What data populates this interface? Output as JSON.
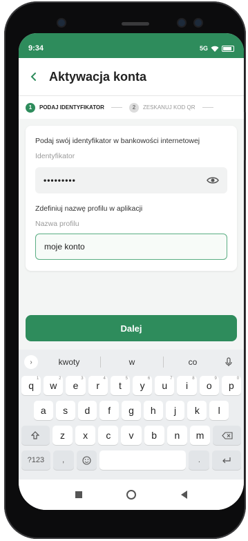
{
  "status_bar": {
    "time": "9:34",
    "signal": "5G"
  },
  "header": {
    "title": "Aktywacja konta"
  },
  "stepper": [
    {
      "number": "1",
      "label": "PODAJ IDENTYFIKATOR",
      "active": true
    },
    {
      "number": "2",
      "label": "ZESKANUJ KOD QR",
      "active": false
    }
  ],
  "form": {
    "intro": "Podaj swój identyfikator w bankowości internetowej",
    "identifier_label": "Identyfikator",
    "identifier_value": "•••••••••",
    "profile_intro": "Zdefiniuj nazwę profilu w aplikacji",
    "profile_label": "Nazwa profilu",
    "profile_value": "moje konto"
  },
  "button": {
    "label": "Dalej"
  },
  "keyboard": {
    "suggestions": [
      "kwoty",
      "w",
      "co"
    ],
    "row1": [
      [
        "q",
        "1"
      ],
      [
        "w",
        "2"
      ],
      [
        "e",
        "3"
      ],
      [
        "r",
        "4"
      ],
      [
        "t",
        "5"
      ],
      [
        "y",
        "6"
      ],
      [
        "u",
        "7"
      ],
      [
        "i",
        "8"
      ],
      [
        "o",
        "9"
      ],
      [
        "p",
        "0"
      ]
    ],
    "row2": [
      "a",
      "s",
      "d",
      "f",
      "g",
      "h",
      "j",
      "k",
      "l"
    ],
    "row3": [
      "z",
      "x",
      "c",
      "v",
      "b",
      "n",
      "m"
    ],
    "row4": {
      "symbols": "?123",
      "comma": ",",
      "period": "."
    }
  },
  "colors": {
    "brand": "#2e8c5c",
    "field_border": "#59ad82"
  }
}
